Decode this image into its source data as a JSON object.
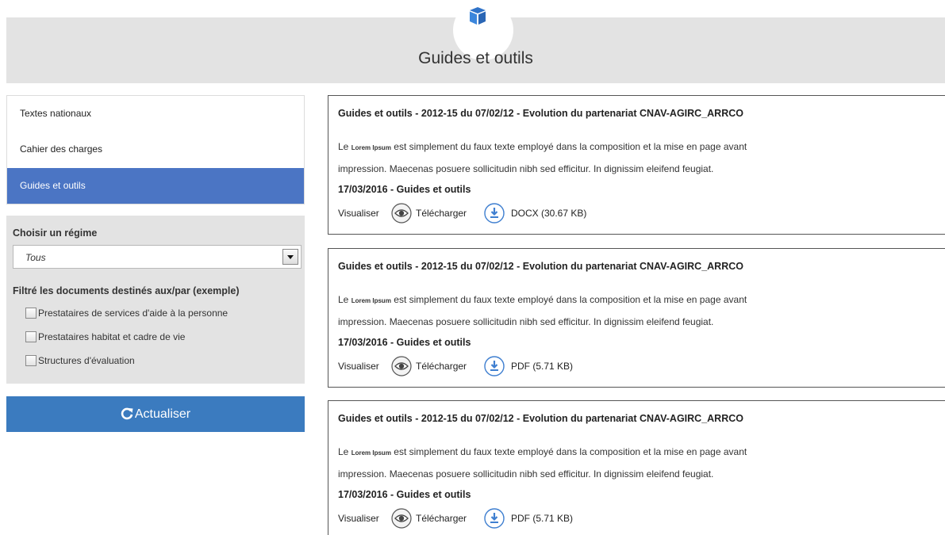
{
  "header": {
    "title": "Guides et outils",
    "icon": "cube-icon"
  },
  "sidenav": {
    "items": [
      {
        "label": "Textes nationaux",
        "active": false
      },
      {
        "label": "Cahier des charges",
        "active": false
      },
      {
        "label": "Guides et outils",
        "active": true
      }
    ]
  },
  "filters": {
    "regime_heading": "Choisir un régime",
    "regime_selected": "Tous",
    "documents_heading": "Filtré les documents destinés aux/par (exemple)",
    "checkboxes": [
      {
        "label": "Prestataires de services d'aide à la personne",
        "checked": false
      },
      {
        "label": "Prestataires habitat et cadre de vie",
        "checked": false
      },
      {
        "label": "Structures d'évaluation",
        "checked": false
      }
    ]
  },
  "refresh_button": {
    "label": "Actualiser",
    "icon": "refresh-icon"
  },
  "documents": [
    {
      "title": "Guides et outils - 2012-15 du 07/02/12 - Evolution du partenariat CNAV-AGIRC_ARRCO",
      "desc_prefix": "Le",
      "desc_lorem": "Lorem Ipsum",
      "desc_line1_rest": "est simplement du faux texte employé dans la composition et la mise en page avant",
      "desc_line2": "impression.  Maecenas posuere sollicitudin nibh sed efficitur. In dignissim eleifend feugiat.",
      "meta": "17/03/2016 - Guides et outils",
      "view_label": "Visualiser",
      "download_label": "Télécharger",
      "file_info": "DOCX (30.67 KB)"
    },
    {
      "title": "Guides et outils - 2012-15 du 07/02/12 - Evolution du partenariat CNAV-AGIRC_ARRCO",
      "desc_prefix": "Le",
      "desc_lorem": "Lorem Ipsum",
      "desc_line1_rest": "est simplement du faux texte employé dans la composition et la mise en page avant",
      "desc_line2": "impression.  Maecenas posuere sollicitudin nibh sed efficitur. In dignissim eleifend feugiat.",
      "meta": "17/03/2016 - Guides et outils",
      "view_label": "Visualiser",
      "download_label": "Télécharger",
      "file_info": "PDF (5.71 KB)"
    },
    {
      "title": "Guides et outils - 2012-15 du 07/02/12 - Evolution du partenariat CNAV-AGIRC_ARRCO",
      "desc_prefix": "Le",
      "desc_lorem": "Lorem Ipsum",
      "desc_line1_rest": "est simplement du faux texte employé dans la composition et la mise en page avant",
      "desc_line2": "impression.  Maecenas posuere sollicitudin nibh sed efficitur. In dignissim eleifend feugiat.",
      "meta": "17/03/2016 - Guides et outils",
      "view_label": "Visualiser",
      "download_label": "Télécharger",
      "file_info": "PDF (5.71 KB)"
    }
  ],
  "colors": {
    "header_band": "#e3e3e3",
    "nav_active": "#4b75c4",
    "refresh_button": "#3b7bbf",
    "icon_accent": "#3f7fd0"
  }
}
